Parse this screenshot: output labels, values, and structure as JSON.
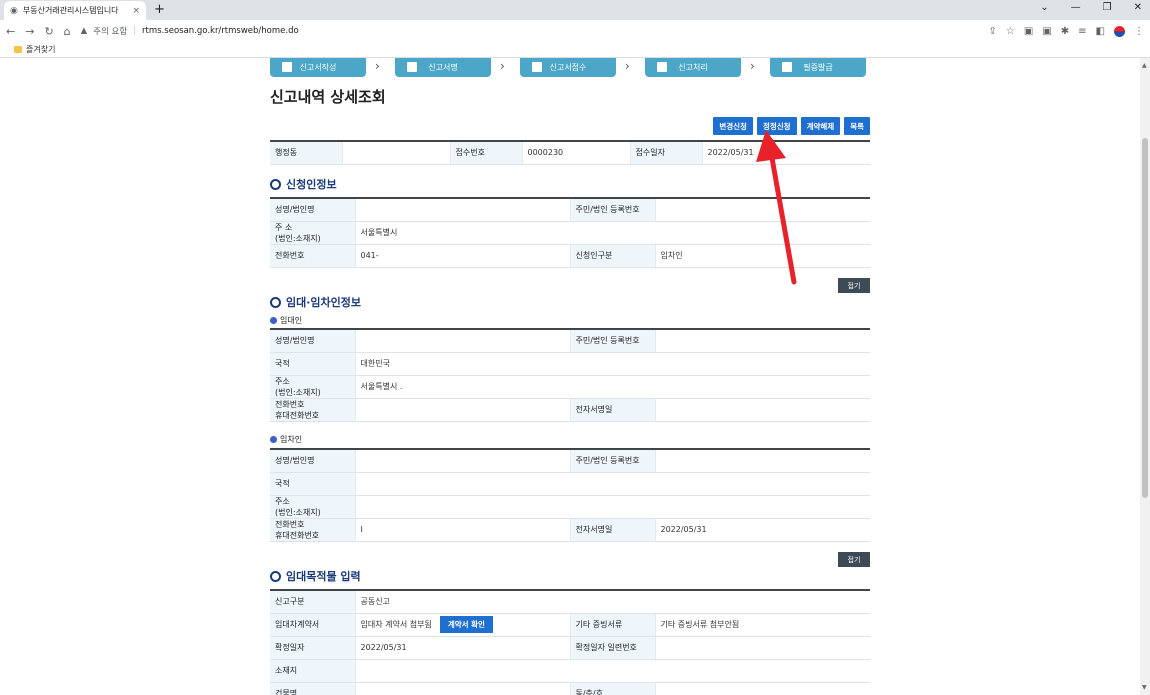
{
  "browser": {
    "tab_title": "부동산거래관리시스템입니다",
    "tab_close": "×",
    "new_tab": "+",
    "security_label": "주의 요함",
    "url": "rtms.seosan.go.kr/rtmsweb/home.do",
    "bookmark": "즐겨찾기"
  },
  "steps": [
    "신고서작성",
    "신고서명",
    "신고서접수",
    "신고처리",
    "필증발급"
  ],
  "page_title": "신고내역 상세조회",
  "actions": [
    "변경신청",
    "정정신청",
    "계약해제",
    "목록"
  ],
  "summary": {
    "h1": "행정동",
    "v1": "",
    "h2": "접수번호",
    "v2": "0000230",
    "h3": "접수일자",
    "v3": "2022/05/31"
  },
  "applicant": {
    "section": "신청인정보",
    "name_h": "성명/법인명",
    "name_v": "",
    "regno_h": "주민/법인 등록번호",
    "regno_v": "",
    "addr_h1": "주    소",
    "addr_h2": "(법인:소재지)",
    "addr_v": "서울특별시",
    "phone_h": "전화번호",
    "phone_v": "041-",
    "type_h": "신청인구분",
    "type_v": "임차인",
    "fold": "접기"
  },
  "parties": {
    "section": "임대·임차인정보",
    "lessor": {
      "label": "임대인",
      "name_h": "성명/법인명",
      "regno_h": "주민/법인 등록번호",
      "nation_h": "국적",
      "nation_v": "대한민국",
      "addr_h1": "주소",
      "addr_h2": "(법인:소재지)",
      "addr_v": "서울특별시 .",
      "phone_h1": "전화번호",
      "phone_h2": "휴대전화번호",
      "phone_v": "",
      "sign_h": "전자서명일",
      "sign_v": ""
    },
    "lessee": {
      "label": "임차인",
      "name_h": "성명/법인명",
      "regno_h": "주민/법인 등록번호",
      "nation_h": "국적",
      "nation_v": "",
      "addr_h1": "주소",
      "addr_h2": "(법인:소재지)",
      "addr_v": "",
      "phone_h1": "전화번호",
      "phone_h2": "휴대전화번호",
      "phone_v": "I",
      "sign_h": "전자서명일",
      "sign_v": "2022/05/31"
    },
    "fold": "접기"
  },
  "property": {
    "section": "임대목적물 입력",
    "report_type_h": "신고구분",
    "report_type_v": "공동신고",
    "contract_h": "임대차계약서",
    "contract_v": "임대차 계약서 첨부됨",
    "contract_btn": "계약서 확인",
    "evidence_h": "기타 증빙서류",
    "evidence_v": "기타 증빙서류 첨부안됨",
    "fixdate_h": "확정일자",
    "fixdate_v": "2022/05/31",
    "fixno_h": "확정일자 일련번호",
    "fixno_v": "",
    "location_h": "소재지",
    "location_v": "",
    "building_h": "건물명",
    "building_v": "",
    "unit_h": "동/층/호",
    "unit_v": ""
  },
  "annotation_color": "#e8222b"
}
